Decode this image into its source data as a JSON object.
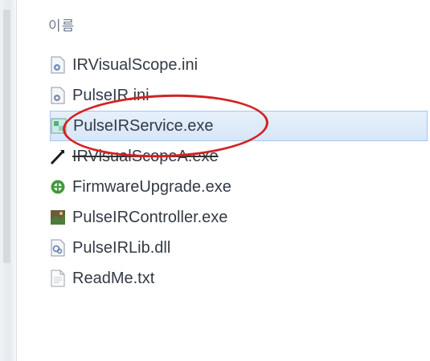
{
  "header": {
    "name_column": "이름"
  },
  "files": [
    {
      "name": "IRVisualScope.ini",
      "icon": "settings-file-icon"
    },
    {
      "name": "PulseIR.ini",
      "icon": "settings-file-icon"
    },
    {
      "name": "PulseIRService.exe",
      "icon": "service-exe-icon",
      "selected": true
    },
    {
      "name": "IRVisualScopeA.exe",
      "icon": "pen-arrow-icon"
    },
    {
      "name": "FirmwareUpgrade.exe",
      "icon": "green-gear-icon"
    },
    {
      "name": "PulseIRController.exe",
      "icon": "controller-app-icon"
    },
    {
      "name": "PulseIRLib.dll",
      "icon": "dll-file-icon"
    },
    {
      "name": "ReadMe.txt",
      "icon": "text-file-icon"
    }
  ],
  "colors": {
    "selection_bg": "#d7e6f7",
    "selection_border": "#a9c6e8",
    "annotation": "#d32222",
    "header_text": "#6b7a90"
  }
}
